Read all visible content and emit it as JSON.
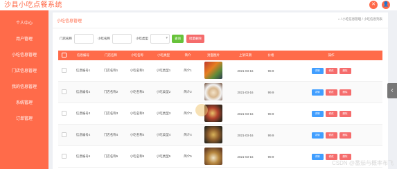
{
  "app": {
    "title": "沙县小吃点餐系统"
  },
  "top_icons": [
    {
      "name": "close-icon",
      "glyph": "✕"
    },
    {
      "name": "user-icon",
      "glyph": "👤"
    }
  ],
  "sidebar": {
    "items": [
      {
        "label": "个人中心"
      },
      {
        "label": "用户管理"
      },
      {
        "label": "小吃信息管理"
      },
      {
        "label": "门店信息管理"
      },
      {
        "label": "我的信息管理"
      },
      {
        "label": "系统管理"
      },
      {
        "label": "订单管理"
      }
    ]
  },
  "breadcrumb": {
    "title": "小吃信息管理",
    "path": "⌂ / 小吃信息管理 / 小吃信息列表"
  },
  "filters": {
    "labels": [
      "门店名称",
      "小吃名称",
      "小吃类型"
    ],
    "select_value": "",
    "search_label": "查询",
    "delete_label": "批量删除"
  },
  "table": {
    "headers": [
      "",
      "信息编号",
      "门店名称",
      "小吃名称",
      "小吃类型",
      "简介",
      "封面图片",
      "上架日期",
      "价格",
      "操作"
    ],
    "rows": [
      {
        "code": "信息编号1",
        "store": "门店名称1",
        "name": "小吃名称1",
        "type": "小吃类型1",
        "intro": "简介1",
        "date": "2021-03-16",
        "price": "99.9"
      },
      {
        "code": "信息编号2",
        "store": "门店名称2",
        "name": "小吃名称2",
        "type": "小吃类型2",
        "intro": "简介2",
        "date": "2021-03-16",
        "price": "99.9"
      },
      {
        "code": "信息编号3",
        "store": "门店名称3",
        "name": "小吃名称3",
        "type": "小吃类型3",
        "intro": "简介3",
        "date": "2021-03-16",
        "price": "99.9"
      },
      {
        "code": "信息编号4",
        "store": "门店名称4",
        "name": "小吃名称4",
        "type": "小吃类型4",
        "intro": "简介4",
        "date": "2021-03-16",
        "price": "99.9"
      },
      {
        "code": "信息编号5",
        "store": "门店名称5",
        "name": "小吃名称5",
        "type": "小吃类型5",
        "intro": "简介5",
        "date": "2021-03-16",
        "price": "99.9"
      }
    ],
    "actions": {
      "detail": "详情",
      "edit": "修改",
      "delete": "删除"
    }
  },
  "side_arrow": "‹",
  "watermark": "CSDN @番茄与概率布飞",
  "colors": {
    "accent": "#ff6b4a",
    "detail_button": "#409eff",
    "danger_button": "#f56c6c",
    "search_button": "#67c23a"
  }
}
